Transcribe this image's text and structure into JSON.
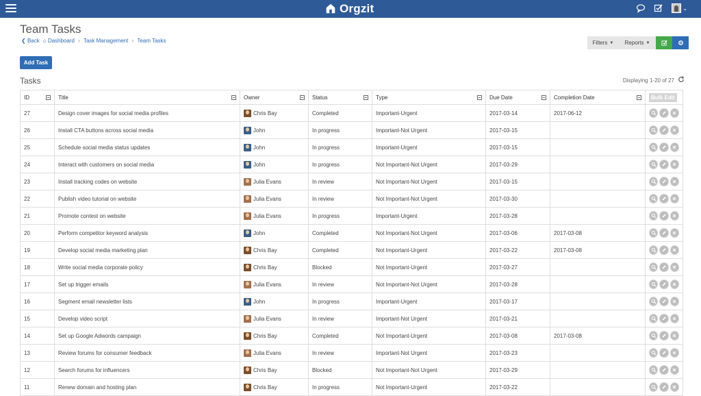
{
  "app": {
    "brand": "Orgzit"
  },
  "header": {
    "title": "Team Tasks",
    "breadcrumb": {
      "back": "Back",
      "dashboard": "Dashboard",
      "section": "Task Management",
      "current": "Team Tasks"
    }
  },
  "toolbar": {
    "filters": "Filters",
    "reports": "Reports"
  },
  "add_task_label": "Add Task",
  "tasks_title": "Tasks",
  "displaying": "Displaying 1-20 of 27",
  "bulk_edit": "Bulk Edit",
  "columns": [
    "ID",
    "Title",
    "Owner",
    "Status",
    "Type",
    "Due Date",
    "Completion Date"
  ],
  "rows": [
    {
      "id": "27",
      "title": "Design cover images for social media profiles",
      "owner": "Chris Bay",
      "status": "Completed",
      "type": "Important-Urgent",
      "due": "2017-03-14",
      "completion": "2017-06-12"
    },
    {
      "id": "26",
      "title": "Install CTA buttons across social media",
      "owner": "John",
      "status": "In progress",
      "type": "Important-Not Urgent",
      "due": "2017-03-15",
      "completion": ""
    },
    {
      "id": "25",
      "title": "Schedule social media status updates",
      "owner": "John",
      "status": "In progress",
      "type": "Important-Urgent",
      "due": "2017-03-15",
      "completion": ""
    },
    {
      "id": "24",
      "title": "Interact with customers on social media",
      "owner": "John",
      "status": "In progress",
      "type": "Not Important-Not Urgent",
      "due": "2017-03-29",
      "completion": ""
    },
    {
      "id": "23",
      "title": "Install tracking codes on website",
      "owner": "Julia Evans",
      "status": "In review",
      "type": "Not Important-Not Urgent",
      "due": "2017-03-15",
      "completion": ""
    },
    {
      "id": "22",
      "title": "Publish video tutorial on website",
      "owner": "Julia Evans",
      "status": "In review",
      "type": "Not Important-Not Urgent",
      "due": "2017-03-30",
      "completion": ""
    },
    {
      "id": "21",
      "title": "Promote contest on website",
      "owner": "Julia Evans",
      "status": "In progress",
      "type": "Important-Urgent",
      "due": "2017-03-28",
      "completion": ""
    },
    {
      "id": "20",
      "title": "Perform competitor keyword analysis",
      "owner": "John",
      "status": "Completed",
      "type": "Not Important-Not Urgent",
      "due": "2017-03-06",
      "completion": "2017-03-08"
    },
    {
      "id": "19",
      "title": "Develop social media marketing plan",
      "owner": "Chris Bay",
      "status": "Completed",
      "type": "Not Important-Urgent",
      "due": "2017-03-22",
      "completion": "2017-03-08"
    },
    {
      "id": "18",
      "title": "Write social media corporate policy",
      "owner": "Chris Bay",
      "status": "Blocked",
      "type": "Not Important-Urgent",
      "due": "2017-03-27",
      "completion": ""
    },
    {
      "id": "17",
      "title": "Set up trigger emails",
      "owner": "Julia Evans",
      "status": "In review",
      "type": "Not Important-Not Urgent",
      "due": "2017-03-28",
      "completion": ""
    },
    {
      "id": "16",
      "title": "Segment email newsletter lists",
      "owner": "John",
      "status": "In progress",
      "type": "Important-Urgent",
      "due": "2017-03-17",
      "completion": ""
    },
    {
      "id": "15",
      "title": "Develop video script",
      "owner": "Julia Evans",
      "status": "In review",
      "type": "Important-Not Urgent",
      "due": "2017-03-21",
      "completion": ""
    },
    {
      "id": "14",
      "title": "Set up Google Adwords campaign",
      "owner": "Chris Bay",
      "status": "Completed",
      "type": "Not Important-Urgent",
      "due": "2017-03-08",
      "completion": "2017-03-08"
    },
    {
      "id": "13",
      "title": "Review forums for consumer feedback",
      "owner": "Julia Evans",
      "status": "In review",
      "type": "Important-Not Urgent",
      "due": "2017-03-23",
      "completion": ""
    },
    {
      "id": "12",
      "title": "Search forums for influencers",
      "owner": "Chris Bay",
      "status": "Blocked",
      "type": "Not Important-Not Urgent",
      "due": "2017-03-29",
      "completion": ""
    },
    {
      "id": "11",
      "title": "Renew domain and hosting plan",
      "owner": "Chris Bay",
      "status": "In progress",
      "type": "Not Important-Urgent",
      "due": "2017-03-22",
      "completion": ""
    }
  ]
}
